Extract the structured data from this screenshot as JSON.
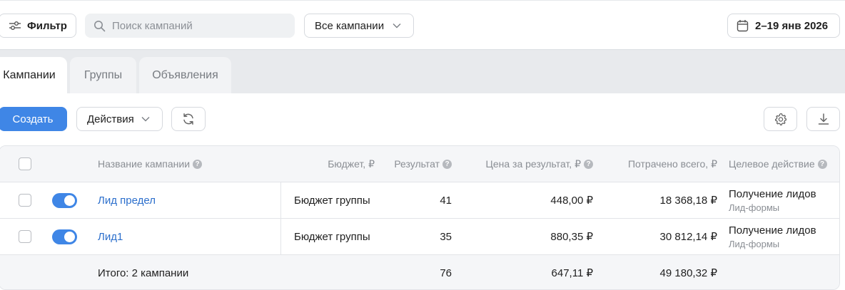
{
  "toolbar": {
    "filter_label": "Фильтр",
    "search_placeholder": "Поиск кампаний",
    "campaign_select": "Все кампании",
    "date_range": "2–19 янв 2026"
  },
  "tabs": [
    {
      "label": "Кампании",
      "active": true
    },
    {
      "label": "Группы",
      "active": false
    },
    {
      "label": "Объявления",
      "active": false
    }
  ],
  "actions": {
    "create_label": "Создать",
    "actions_label": "Действия"
  },
  "table": {
    "headers": {
      "name": "Название кампании",
      "budget": "Бюджет, ₽",
      "result": "Результат",
      "cost_per_result": "Цена за результат, ₽",
      "spent": "Потрачено всего, ₽",
      "objective": "Целевое действие"
    },
    "rows": [
      {
        "name": "Лид предел",
        "enabled": true,
        "budget": "Бюджет группы",
        "result": "41",
        "cost_per_result": "448,00 ₽",
        "spent": "18 368,18 ₽",
        "objective": "Получение лидов",
        "objective_sub": "Лид-формы"
      },
      {
        "name": "Лид1",
        "enabled": true,
        "budget": "Бюджет группы",
        "result": "35",
        "cost_per_result": "880,35 ₽",
        "spent": "30 812,14 ₽",
        "objective": "Получение лидов",
        "objective_sub": "Лид-формы"
      }
    ],
    "total": {
      "label": "Итого: 2 кампании",
      "result": "76",
      "cost_per_result": "647,11 ₽",
      "spent": "49 180,32 ₽"
    }
  },
  "colors": {
    "accent": "#3f86e6",
    "link": "#2c6fcc",
    "muted_text": "#8a8e94"
  },
  "icons": [
    "sliders-icon",
    "search-icon",
    "chevron-down-icon",
    "calendar-icon",
    "refresh-icon",
    "gear-icon",
    "download-icon",
    "help-icon"
  ]
}
